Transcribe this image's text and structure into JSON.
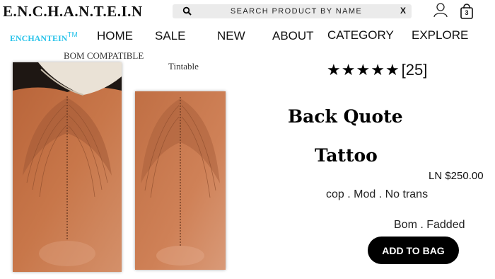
{
  "header": {
    "logo": "E.N.C.H.A.N.T.E.I.N",
    "search": {
      "placeholder": "SEARCH PRODUCT BY NAME",
      "clear_label": "X"
    },
    "bag_count": "3"
  },
  "brand": {
    "name": "ENCHANTEIN",
    "mark": "TM"
  },
  "nav": {
    "items": [
      "HOME",
      "SALE",
      "NEW",
      "ABOUT",
      "CATEGORY",
      "EXPLORE"
    ]
  },
  "product": {
    "label_left": "BOM COMPATIBLE",
    "label_right": "Tintable",
    "rating": {
      "stars": 5,
      "count_text": "[25]"
    },
    "title_line1": "Back Quote",
    "title_line2": "Tattoo",
    "price": "LN $250.00",
    "permissions": "cop . Mod . No trans",
    "variant": "Bom . Fadded",
    "add_to_bag": "ADD TO BAG"
  },
  "icons": [
    "search-icon",
    "user-icon",
    "shopping-bag-icon",
    "star-icon"
  ]
}
